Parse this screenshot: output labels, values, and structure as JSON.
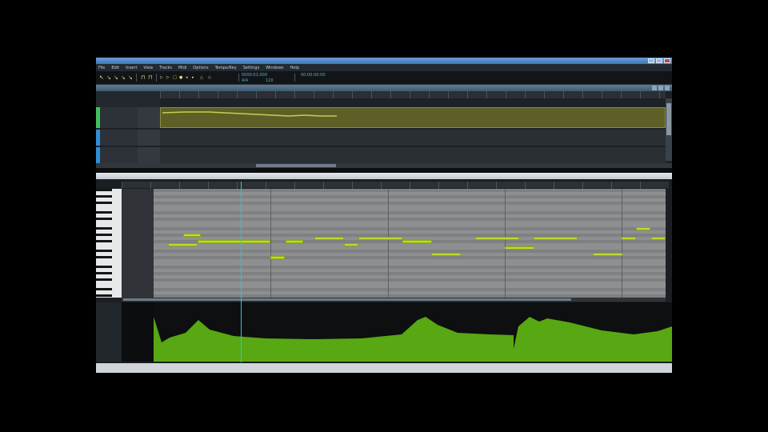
{
  "window": {
    "title": ""
  },
  "menu": {
    "items": [
      "File",
      "Edit",
      "Insert",
      "View",
      "Tracks",
      "Midi",
      "Options",
      "Tempo/Key",
      "Settings",
      "Windows",
      "Help"
    ]
  },
  "toolbar": {
    "tools": [
      "select-tool",
      "draw-tool",
      "erase-tool",
      "split-tool",
      "mute-tool",
      "zoom-tool",
      "snap-tool"
    ],
    "readouts": [
      "0000:01:000",
      "4/4",
      "120",
      "00:00:00:00"
    ]
  },
  "track_view": {
    "title": "",
    "tracks": [
      {
        "name": "",
        "color": "#3fc25a",
        "clip_label": "",
        "clip_sub": ""
      },
      {
        "name": "",
        "color": "#2d8fd8"
      },
      {
        "name": "",
        "color": "#2d8fd8"
      }
    ]
  },
  "piano_roll": {
    "title": "",
    "accent_color": "#b9e02a",
    "playhead_color": "#26c9d6",
    "notes": [
      {
        "start": 0.5,
        "length": 1,
        "pitch_row": 17
      },
      {
        "start": 1.0,
        "length": 0.6,
        "pitch_row": 14
      },
      {
        "start": 1.5,
        "length": 2.5,
        "pitch_row": 16
      },
      {
        "start": 4.0,
        "length": 0.5,
        "pitch_row": 21
      },
      {
        "start": 4.5,
        "length": 0.6,
        "pitch_row": 16
      },
      {
        "start": 5.5,
        "length": 1.0,
        "pitch_row": 15
      },
      {
        "start": 6.5,
        "length": 0.5,
        "pitch_row": 17
      },
      {
        "start": 7.0,
        "length": 1.5,
        "pitch_row": 15
      },
      {
        "start": 8.5,
        "length": 1.0,
        "pitch_row": 16
      },
      {
        "start": 9.5,
        "length": 1.0,
        "pitch_row": 20
      },
      {
        "start": 11.0,
        "length": 1.5,
        "pitch_row": 15
      },
      {
        "start": 12.0,
        "length": 1.0,
        "pitch_row": 18
      },
      {
        "start": 13.0,
        "length": 1.5,
        "pitch_row": 15
      },
      {
        "start": 15.0,
        "length": 1.0,
        "pitch_row": 20
      },
      {
        "start": 16.0,
        "length": 0.5,
        "pitch_row": 15
      },
      {
        "start": 16.5,
        "length": 0.5,
        "pitch_row": 12
      },
      {
        "start": 17.0,
        "length": 0.5,
        "pitch_row": 15
      }
    ],
    "beats_total": 17.5,
    "velocity_lane": {
      "fill_color": "#57a812",
      "labels": [
        "",
        ""
      ]
    }
  }
}
